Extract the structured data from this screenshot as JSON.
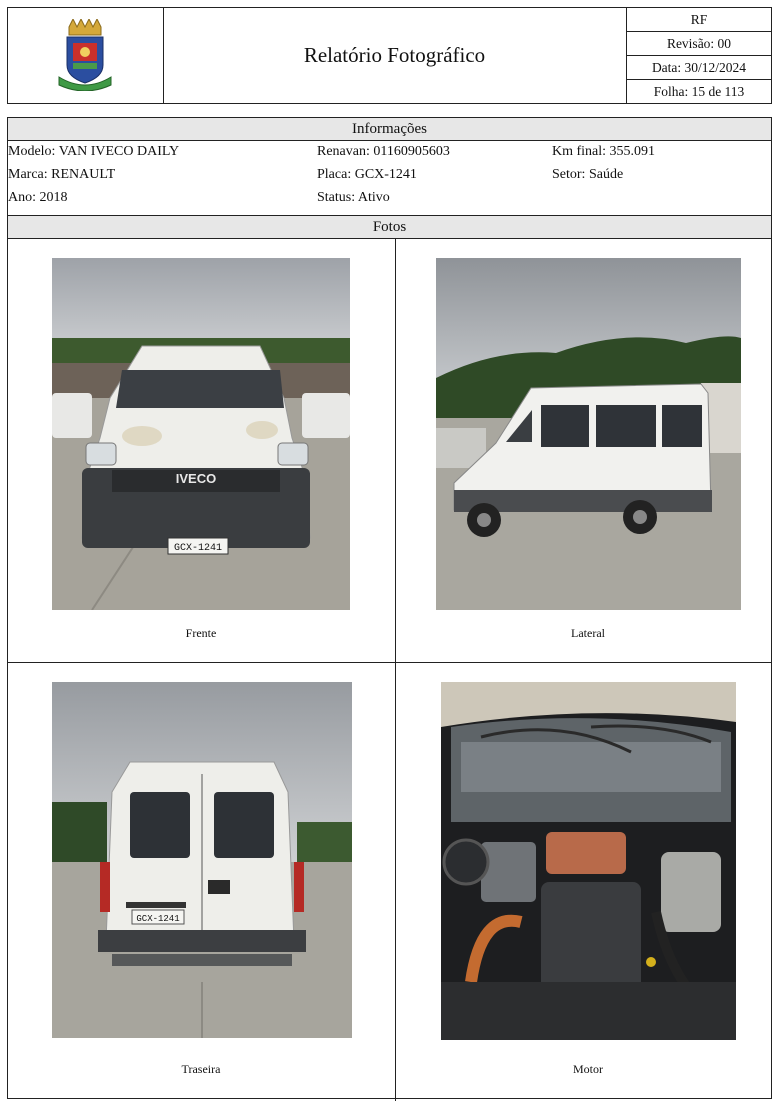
{
  "header": {
    "title": "Relatório Fotográfico",
    "code": "RF",
    "revision": "Revisão: 00",
    "date": "Data: 30/12/2024",
    "sheet": "Folha: 15 de 113"
  },
  "info": {
    "section_title": "Informações",
    "model": "Modelo: VAN IVECO DAILY",
    "brand": "Marca: RENAULT",
    "year": "Ano: 2018",
    "renavan": "Renavan: 01160905603",
    "plate": "Placa: GCX-1241",
    "status": "Status: Ativo",
    "km": "Km final: 355.091",
    "sector": "Setor: Saúde"
  },
  "photos": {
    "section_title": "Fotos",
    "items": [
      {
        "caption": "Frente",
        "badge_text": "IVECO",
        "plate_text": "GCX-1241"
      },
      {
        "caption": "Lateral"
      },
      {
        "caption": "Traseira",
        "plate_text": "GCX-1241"
      },
      {
        "caption": "Motor"
      }
    ]
  },
  "colors": {
    "border": "#222222",
    "section_bg": "#e7e7e7",
    "van_white": "#f1f1ee",
    "sky": "#c9ccd0",
    "ground": "#a9a79f"
  }
}
